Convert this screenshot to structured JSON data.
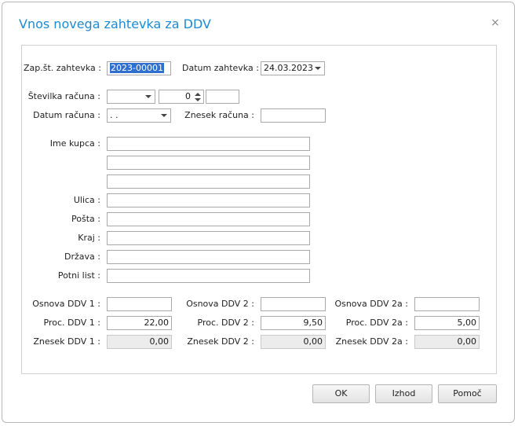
{
  "window": {
    "title": "Vnos novega zahtevka za DDV",
    "close_icon": "×"
  },
  "form": {
    "zap_st": {
      "label": "Zap.št. zahtevka :",
      "value": "2023-00001"
    },
    "datum_zahtevka": {
      "label": "Datum zahtevka :",
      "value": "24.03.2023"
    },
    "stevilka_racuna": {
      "label": "Številka računa :",
      "select_value": "",
      "spin_value": "0",
      "extra_value": ""
    },
    "datum_racuna": {
      "label": "Datum računa :",
      "value": " .  ."
    },
    "znesek_racuna": {
      "label": "Znesek računa :",
      "value": ""
    },
    "ime_kupca": {
      "label": "Ime kupca :",
      "lines": [
        "",
        "",
        ""
      ]
    },
    "ulica": {
      "label": "Ulica :",
      "value": ""
    },
    "posta": {
      "label": "Pošta :",
      "value": ""
    },
    "kraj": {
      "label": "Kraj :",
      "value": ""
    },
    "drzava": {
      "label": "Država :",
      "value": ""
    },
    "potni_list": {
      "label": "Potni list :",
      "value": ""
    },
    "ddv": [
      {
        "osnova_label": "Osnova DDV 1 :",
        "osnova": "",
        "proc_label": "Proc. DDV 1 :",
        "proc": "22,00",
        "znesek_label": "Znesek DDV 1 :",
        "znesek": "0,00"
      },
      {
        "osnova_label": "Osnova DDV 2 :",
        "osnova": "",
        "proc_label": "Proc. DDV 2 :",
        "proc": "9,50",
        "znesek_label": "Znesek DDV 2 :",
        "znesek": "0,00"
      },
      {
        "osnova_label": "Osnova DDV 2a :",
        "osnova": "",
        "proc_label": "Proc. DDV 2a :",
        "proc": "5,00",
        "znesek_label": "Znesek DDV 2a :",
        "znesek": "0,00"
      }
    ]
  },
  "buttons": {
    "ok": "OK",
    "izhod": "Izhod",
    "pomoc": "Pomoč"
  }
}
